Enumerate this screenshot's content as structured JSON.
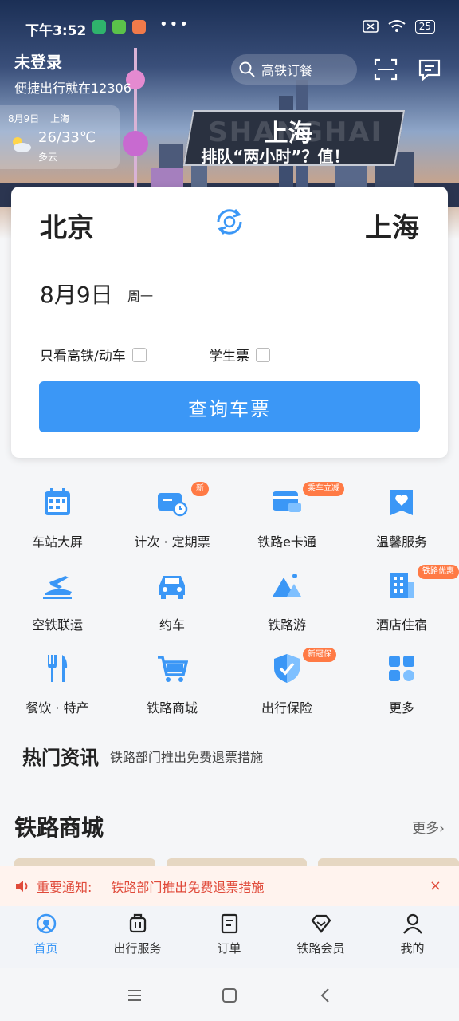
{
  "status": {
    "time": "下午3:52",
    "battery": "25",
    "dots": "•••"
  },
  "header": {
    "login_title": "未登录",
    "login_sub": "便捷出行就在12306",
    "search_placeholder": "高铁订餐"
  },
  "weather": {
    "date": "8月9日",
    "city": "上海",
    "temp": "26/33℃",
    "condition": "多云"
  },
  "banner": {
    "city": "上海",
    "bgword": "SHANGHAI",
    "slogan": "排队“两小时”？值！"
  },
  "booking": {
    "from": "北京",
    "to": "上海",
    "date": "8月9日",
    "weekday": "周一",
    "opt_highspeed": "只看高铁/动车",
    "opt_student": "学生票",
    "query": "查询车票"
  },
  "services": [
    {
      "label": "车站大屏",
      "icon": "station-screen-icon"
    },
    {
      "label": "计次 · 定期票",
      "icon": "periodic-ticket-icon",
      "tag": "新"
    },
    {
      "label": "铁路e卡通",
      "icon": "ecard-icon",
      "tag": "乘车立减"
    },
    {
      "label": "温馨服务",
      "icon": "care-service-icon"
    },
    {
      "label": "空铁联运",
      "icon": "air-rail-icon"
    },
    {
      "label": "约车",
      "icon": "car-icon"
    },
    {
      "label": "铁路游",
      "icon": "rail-tour-icon"
    },
    {
      "label": "酒店住宿",
      "icon": "hotel-icon",
      "tag": "铁路优惠"
    },
    {
      "label": "餐饮 · 特产",
      "icon": "dining-icon"
    },
    {
      "label": "铁路商城",
      "icon": "mall-cart-icon"
    },
    {
      "label": "出行保险",
      "icon": "insurance-shield-icon",
      "tag": "新冠保"
    },
    {
      "label": "更多",
      "icon": "more-grid-icon"
    }
  ],
  "hot": {
    "title": "热门资讯",
    "text": "铁路部门推出免费退票措施"
  },
  "mall": {
    "title": "铁路商城",
    "more": "更多›"
  },
  "notice": {
    "label": "重要通知:",
    "text": "铁路部门推出免费退票措施",
    "close": "×"
  },
  "tabs": [
    {
      "label": "首页"
    },
    {
      "label": "出行服务"
    },
    {
      "label": "订单"
    },
    {
      "label": "铁路会员"
    },
    {
      "label": "我的"
    }
  ],
  "colors": {
    "primary": "#3b97f6",
    "notice": "#e04a3a",
    "tag": "#ff7a45"
  }
}
